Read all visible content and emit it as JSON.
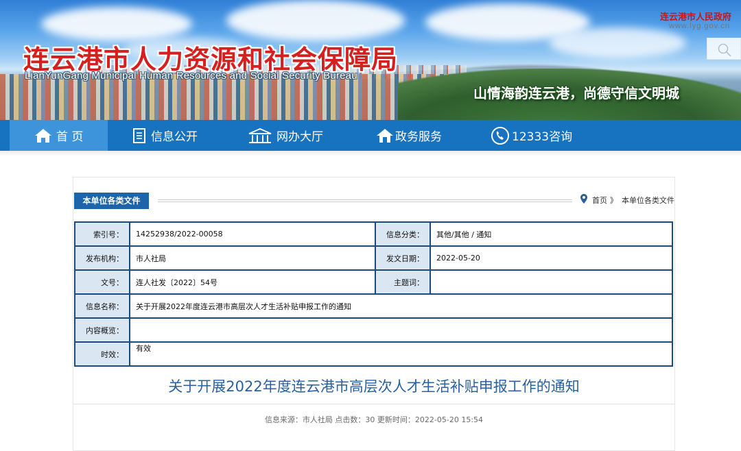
{
  "header": {
    "title": "连云港市人力资源和社会保障局",
    "subtitle": "LianYunGang Municipal Human Resources and Social Security Bureau",
    "slogan": "山情海韵连云港，尚德守信文明城",
    "gov_link": "连云港市人民政府",
    "gov_url": "www.lyg.gov.cn",
    "search_icon": "search-icon"
  },
  "nav": {
    "items": [
      {
        "label": "首 页",
        "icon": "home-icon"
      },
      {
        "label": "信息公开",
        "icon": "document-icon"
      },
      {
        "label": "网办大厅",
        "icon": "building-icon"
      },
      {
        "label": "政务服务",
        "icon": "house-hand-icon"
      },
      {
        "label": "12333咨询",
        "icon": "phone-icon"
      }
    ]
  },
  "section": {
    "tag": "本单位各类文件",
    "breadcrumb": {
      "home": "首页",
      "separator": "》",
      "current": "本单位各类文件"
    }
  },
  "meta": {
    "index_label": "索引号：",
    "index_value": "14252938/2022-00058",
    "category_label": "信息分类：",
    "category_value": "其他/其他 / 通知",
    "publisher_label": "发布机构：",
    "publisher_value": "市人社局",
    "date_label": "发文日期：",
    "date_value": "2022-05-20",
    "doc_no_label": "文号：",
    "doc_no_value": "连人社发〔2022〕54号",
    "subject_label": "主题词：",
    "subject_value": "",
    "name_label": "信息名称：",
    "name_value": "关于开展2022年度连云港市高层次人才生活补贴申报工作的通知",
    "summary_label": "内容概览：",
    "summary_value": "",
    "validity_label": "时效：",
    "validity_value": "有效"
  },
  "article": {
    "title": "关于开展2022年度连云港市高层次人才生活补贴申报工作的通知",
    "info": "信息来源：市人社局 点击数：30 更新时间：2022-05-20 15:54"
  }
}
